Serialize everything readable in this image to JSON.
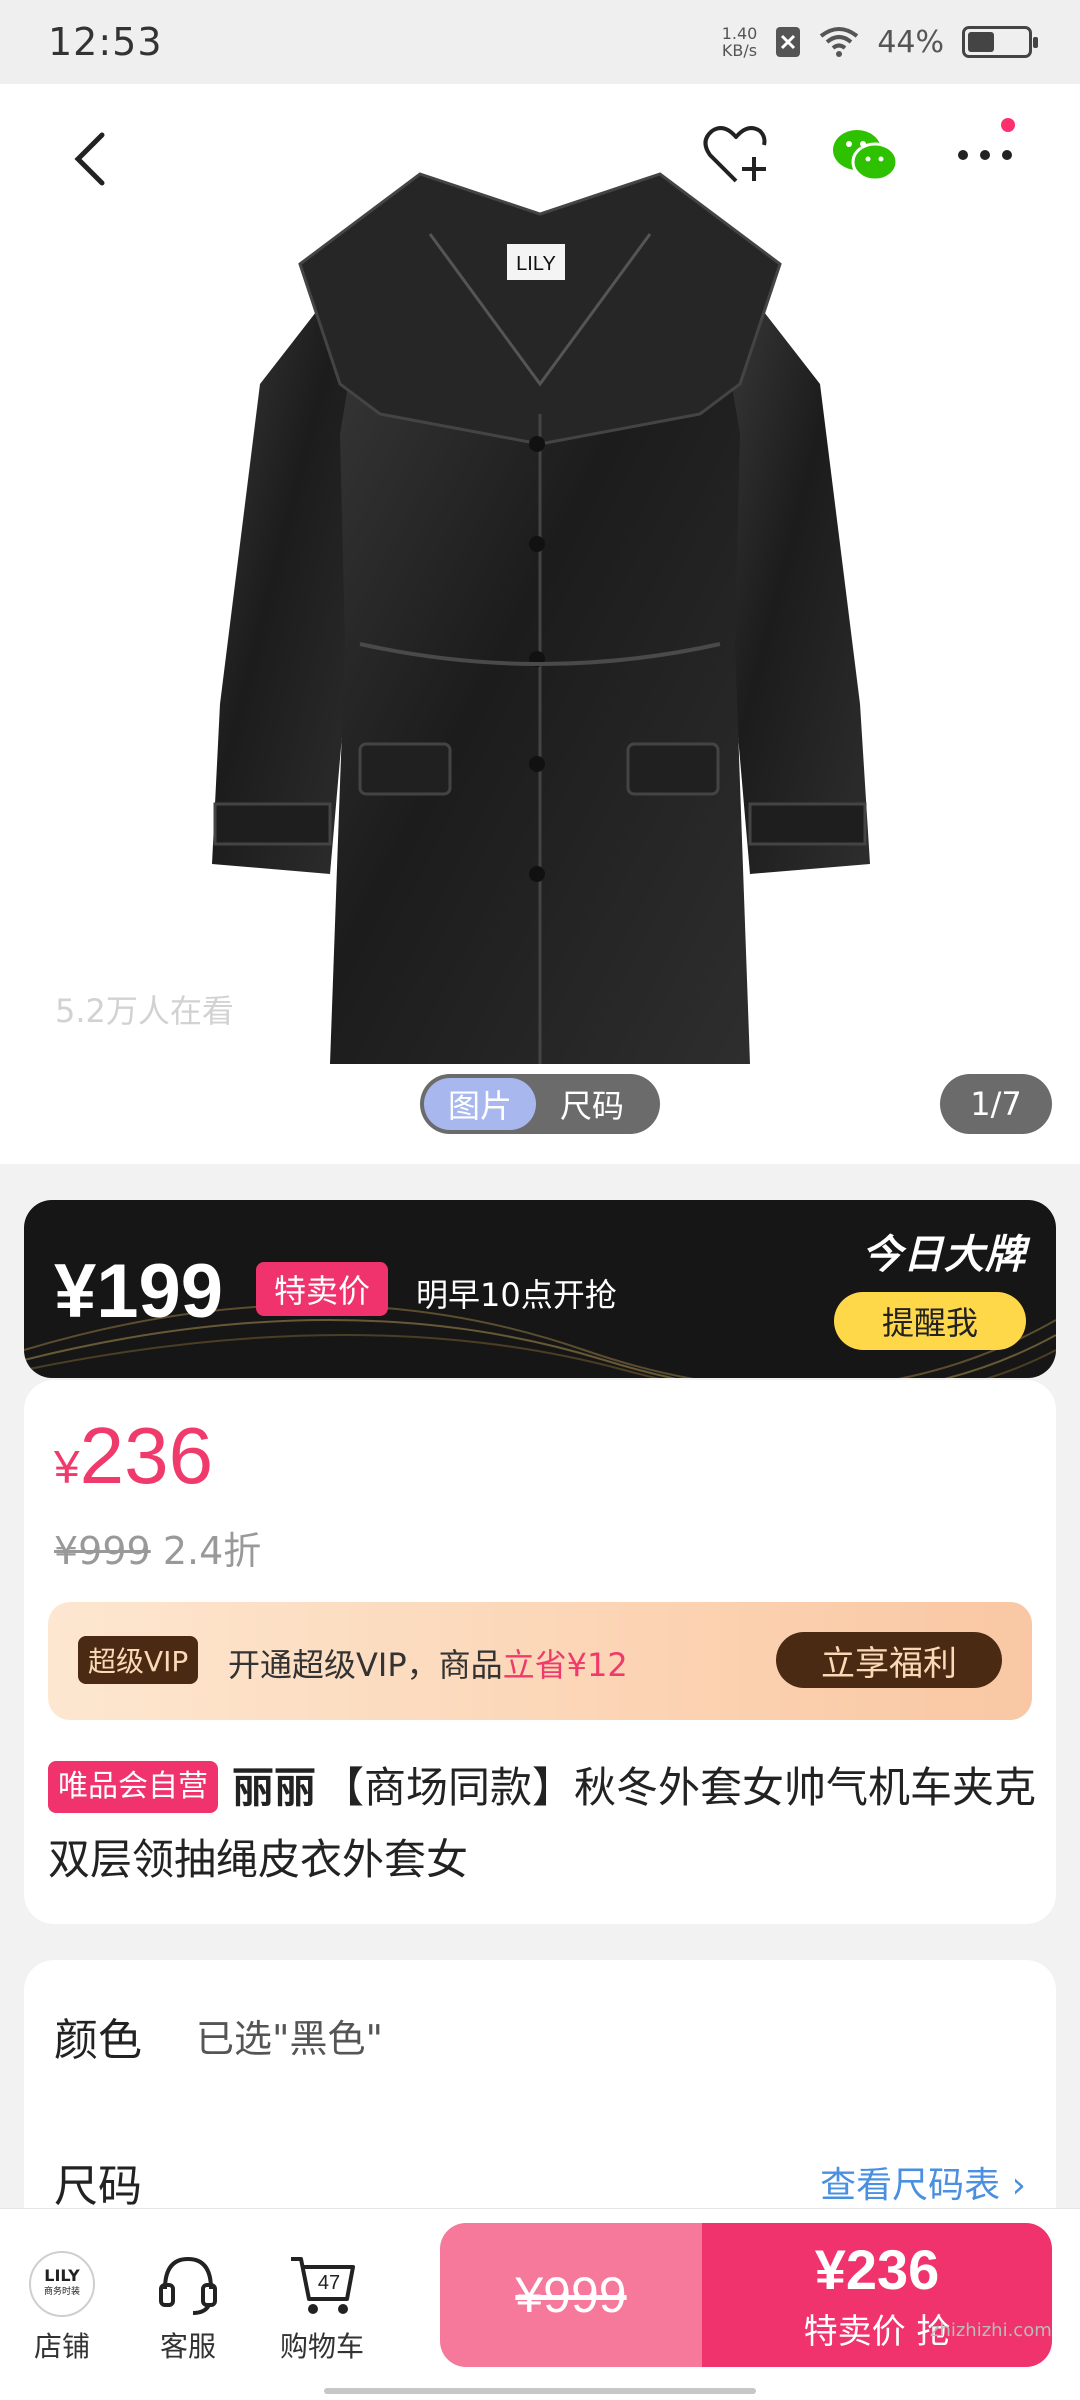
{
  "status_bar": {
    "time": "12:53",
    "net_speed_top": "1.40",
    "net_speed_bottom": "KB/s",
    "battery": "44%",
    "battery_level": 0.44
  },
  "hero": {
    "viewers": "5.2万人在看",
    "toggle": [
      "图片",
      "尺码"
    ],
    "pager": "1/7",
    "coat_logo": "LILY"
  },
  "banner": {
    "price": "¥199",
    "tag": "特卖价",
    "start_text": "明早10点开抢",
    "brand_day": "今日大牌",
    "remind_button": "提醒我"
  },
  "price_card": {
    "currency": "¥",
    "current_price": "236",
    "original_price": "¥999",
    "discount": "2.4折",
    "vip": {
      "badge": "超级VIP",
      "text_before": "开通超级VIP，商品",
      "text_highlight": "立省¥12",
      "cta": "立享福利"
    },
    "self_badge": "唯品会自营",
    "brand": "丽丽",
    "title": "【商场同款】秋冬外套女帅气机车夹克双层领抽绳皮衣外套女"
  },
  "spec": {
    "color_label": "颜色",
    "color_value": "已选\"黑色\"",
    "size_label": "尺码",
    "size_link": "查看尺码表 ›"
  },
  "bottom_bar": {
    "shop_logo_top": "LILY",
    "shop_logo_bottom": "商务时装",
    "shop": "店铺",
    "service": "客服",
    "cart": "购物车",
    "cart_count": "47",
    "buy_original": "¥999",
    "buy_price": "¥236",
    "buy_label": "特卖价 抢"
  },
  "watermark": "zhizhizhi.com",
  "colors": {
    "accent_pink": "#f0336d",
    "vip_brown": "#4b2a14",
    "link_blue": "#4a8fe0",
    "remind_yellow": "#ffd84a"
  }
}
